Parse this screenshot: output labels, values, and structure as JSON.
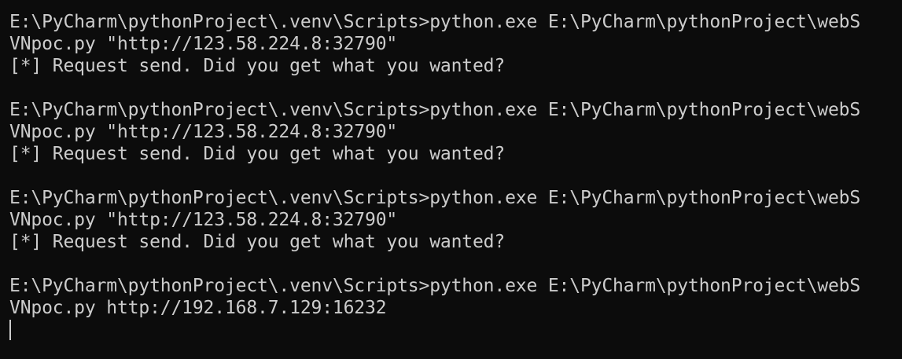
{
  "terminal": {
    "blocks": [
      {
        "cmd_line1": "E:\\PyCharm\\pythonProject\\.venv\\Scripts>python.exe E:\\PyCharm\\pythonProject\\webS",
        "cmd_line2": "VNpoc.py \"http://123.58.224.8:32790\"",
        "output": "[*] Request send. Did you get what you wanted?"
      },
      {
        "cmd_line1": "E:\\PyCharm\\pythonProject\\.venv\\Scripts>python.exe E:\\PyCharm\\pythonProject\\webS",
        "cmd_line2": "VNpoc.py \"http://123.58.224.8:32790\"",
        "output": "[*] Request send. Did you get what you wanted?"
      },
      {
        "cmd_line1": "E:\\PyCharm\\pythonProject\\.venv\\Scripts>python.exe E:\\PyCharm\\pythonProject\\webS",
        "cmd_line2": "VNpoc.py \"http://123.58.224.8:32790\"",
        "output": "[*] Request send. Did you get what you wanted?"
      },
      {
        "cmd_line1": "E:\\PyCharm\\pythonProject\\.venv\\Scripts>python.exe E:\\PyCharm\\pythonProject\\webS",
        "cmd_line2": "VNpoc.py http://192.168.7.129:16232"
      }
    ]
  },
  "colors": {
    "background": "#0c0c0c",
    "foreground": "#cccccc"
  }
}
